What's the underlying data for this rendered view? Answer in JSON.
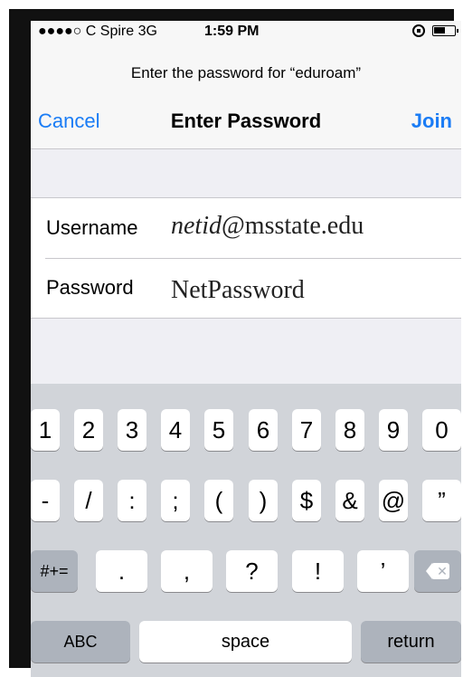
{
  "status": {
    "carrier": "●●●●○ C Spire  3G",
    "time": "1:59 PM"
  },
  "nav": {
    "prompt": "Enter the password for “eduroam”",
    "cancel": "Cancel",
    "title": "Enter Password",
    "join": "Join"
  },
  "form": {
    "username_label": "Username",
    "username_value_italic": "netid",
    "username_value_rest": "@msstate.edu",
    "password_label": "Password",
    "password_value": "NetPassword"
  },
  "keyboard": {
    "row1": [
      "1",
      "2",
      "3",
      "4",
      "5",
      "6",
      "7",
      "8",
      "9",
      "0"
    ],
    "row2": [
      "-",
      "/",
      ":",
      ";",
      "(",
      ")",
      "$",
      "&",
      "@",
      "”"
    ],
    "row3": [
      ".",
      ",",
      "?",
      "!",
      "’"
    ],
    "symbols_key": "#+=",
    "abc_key": "ABC",
    "space_key": "space",
    "return_key": "return"
  }
}
